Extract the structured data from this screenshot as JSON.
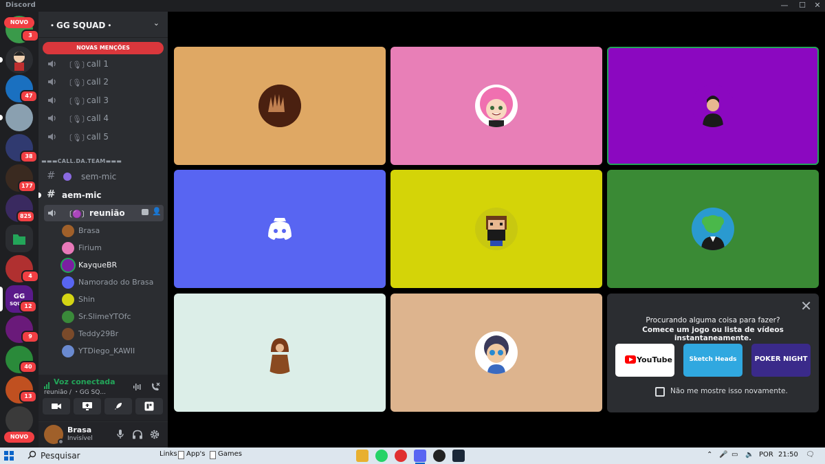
{
  "window": {
    "app_name": "Discord"
  },
  "rail": {
    "novo_top": "NOVO",
    "novo_bottom": "NOVO",
    "badges": [
      "3",
      "47",
      "38",
      "177",
      "825",
      "4",
      "12",
      "9",
      "40",
      "13"
    ]
  },
  "server": {
    "name": "・GG SQUAD・",
    "new_mentions": "NOVAS MENÇÕES",
    "voice_channels": [
      {
        "prefix": "〔🎙〕",
        "label": "call 1"
      },
      {
        "prefix": "〔🎙〕",
        "label": "call 2"
      },
      {
        "prefix": "〔🎙〕",
        "label": "call 3"
      },
      {
        "prefix": "〔🎙〕",
        "label": "call 4"
      },
      {
        "prefix": "〔🎙〕",
        "label": "call 5"
      }
    ],
    "category": "▬▬▬CALL.DA.TEAM▬▬▬",
    "text_channels": [
      {
        "label": "sem-mic"
      },
      {
        "label": "aem-mic"
      }
    ],
    "active_voice": {
      "prefix": "〔🟣〕",
      "label": "reunião"
    },
    "members": [
      {
        "name": "Brasa",
        "color": "#a0602a"
      },
      {
        "name": "Firium",
        "color": "#e879b9"
      },
      {
        "name": "KayqueBR",
        "color": "#7b1fa2"
      },
      {
        "name": "Namorado do Brasa",
        "color": "#5865f2"
      },
      {
        "name": "Shin",
        "color": "#d4d414"
      },
      {
        "name": "Sr.SlimeYTOfc",
        "color": "#3a8a3a"
      },
      {
        "name": "Teddy29Br",
        "color": "#7a4a2a"
      },
      {
        "name": "YTDiego_KAWII",
        "color": "#6a8ad0"
      }
    ]
  },
  "voice_panel": {
    "status": "Voz conectada",
    "location": "reunião / ・GG SQ..."
  },
  "user_panel": {
    "name": "Brasa",
    "status": "Invisível"
  },
  "stage": {
    "tiles": [
      {
        "name": "Brasa",
        "bg": "#dfa864",
        "pfp": "#5a2a10"
      },
      {
        "name": "Firium",
        "bg": "#e87fb7",
        "pfp": "#f070b0"
      },
      {
        "name": "KayqueBR",
        "bg": "#8b08c0",
        "pfp": "#6a0aa0",
        "speaking": true
      },
      {
        "name": "Namorado do Brasa",
        "bg": "#5865f2",
        "pfp": "discord-default"
      },
      {
        "name": "Shin",
        "bg": "#d4d408",
        "pfp": "#c8c810"
      },
      {
        "name": "Sr.SlimeYTOfc",
        "bg": "#3a8a35",
        "pfp": "#2a9ad0"
      },
      {
        "name": "Teddy29Br",
        "bg": "#dceee8",
        "pfp": "#7a3a18"
      },
      {
        "name": "YTDiego_KAWII",
        "bg": "#ddb48e",
        "pfp": "#3a6ac0"
      }
    ],
    "activity": {
      "line1": "Procurando alguma coisa para fazer?",
      "line2": "Comece um jogo ou lista de vídeos instantaneamente.",
      "cards": [
        {
          "label": "YouTube",
          "bg": "#ffffff"
        },
        {
          "label": "Sketch Heads",
          "bg": "#30a8e0"
        },
        {
          "label": "POKER NIGHT",
          "bg": "#3a2a8a"
        }
      ],
      "checkbox_label": "Não me mostre isso novamente."
    }
  },
  "taskbar": {
    "search_placeholder": "Pesquisar",
    "links": "Links",
    "apps": "App's",
    "games": "Games",
    "language": "POR",
    "time": "21:50"
  },
  "colors": {
    "accent": "#5865f2",
    "green": "#23a559",
    "red": "#f23f43"
  }
}
